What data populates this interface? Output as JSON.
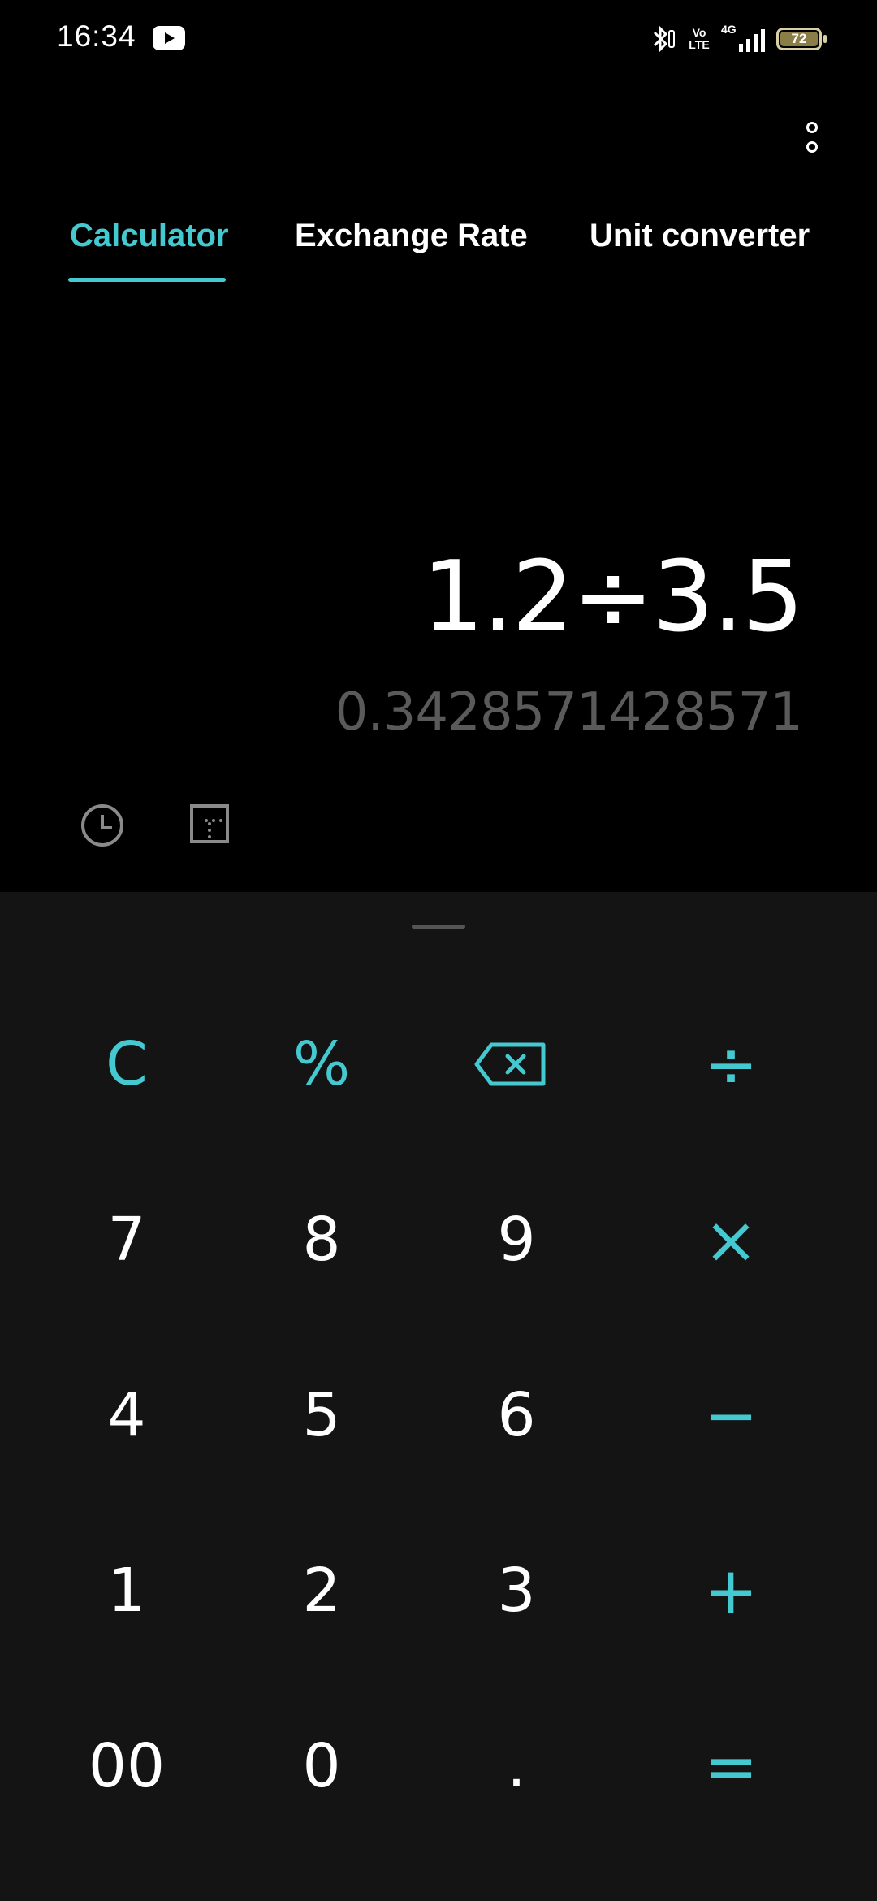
{
  "status_bar": {
    "time": "16:34",
    "notification_icons": [
      "youtube-icon"
    ],
    "system_icons": [
      "bluetooth-icon",
      "volte-icon",
      "4g-signal-icon",
      "battery-icon"
    ],
    "volte_label": "Vo\nLTE",
    "network_label": "4G",
    "battery_level": "72"
  },
  "app_bar": {
    "more_icon": "more-vertical-icon"
  },
  "tabs": [
    {
      "label": "Calculator",
      "active": true
    },
    {
      "label": "Exchange Rate",
      "active": false
    },
    {
      "label": "Unit converter",
      "active": false
    }
  ],
  "display": {
    "expression": "1.2÷3.5",
    "result": "0.3428571428571"
  },
  "tools": {
    "history_icon": "history-clock-icon",
    "scientific_icon": "scientific-mode-icon"
  },
  "keypad": {
    "row1": [
      "C",
      "%",
      "backspace",
      "÷"
    ],
    "row2": [
      "7",
      "8",
      "9",
      "×"
    ],
    "row3": [
      "4",
      "5",
      "6",
      "−"
    ],
    "row4": [
      "1",
      "2",
      "3",
      "+"
    ],
    "row5": [
      "00",
      "0",
      ".",
      "="
    ]
  },
  "colors": {
    "accent": "#45c9d1",
    "display_bg": "#000000",
    "keypad_bg": "#141414",
    "result_text": "#5a5a5a"
  }
}
